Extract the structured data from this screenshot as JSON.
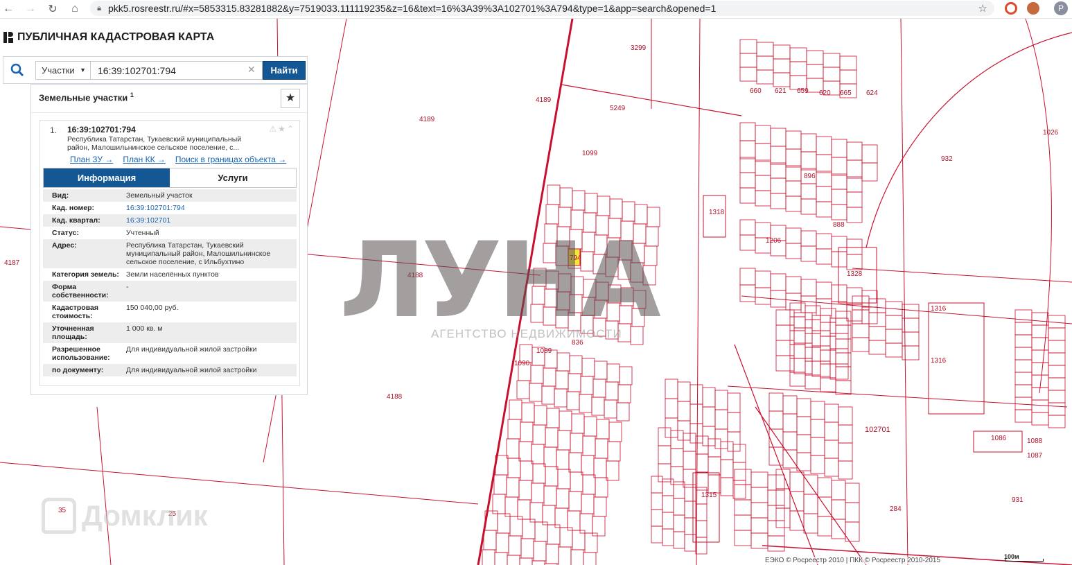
{
  "browser": {
    "url": "pkk5.rosreestr.ru/#x=5853315.83281882&y=7519033.111119235&z=16&text=16%3A39%3A102701%3A794&type=1&app=search&opened=1",
    "profile_initial": "P"
  },
  "app": {
    "title": "ПУБЛИЧНАЯ КАДАСТРОВАЯ КАРТА"
  },
  "search": {
    "type_value": "Участки",
    "query": "16:39:102701:794",
    "button_label": "Найти"
  },
  "results": {
    "header": "Земельные участки",
    "count": "1",
    "item": {
      "number": "1.",
      "title": "16:39:102701:794",
      "address_short": "Республика Татарстан, Тукаевский муниципальный район, Малошильнинское сельское поселение, с...",
      "links": [
        "План ЗУ →",
        "План КК →",
        "Поиск в границах объекта →"
      ],
      "tabs": [
        "Информация",
        "Услуги"
      ],
      "info": [
        {
          "k": "Вид:",
          "v": "Земельный участок"
        },
        {
          "k": "Кад. номер:",
          "v": "16:39:102701:794",
          "link": true
        },
        {
          "k": "Кад. квартал:",
          "v": "16:39:102701",
          "link": true
        },
        {
          "k": "Статус:",
          "v": "Учтенный"
        },
        {
          "k": "Адрес:",
          "v": "Республика Татарстан, Тукаевский муниципальный район, Малошильнинское сельское поселение, с Ильбухтино"
        },
        {
          "k": "Категория земель:",
          "v": "Земли населённых пунктов"
        },
        {
          "k": "Форма собственности:",
          "v": "-"
        },
        {
          "k": "Кадастровая стоимость:",
          "v": "150 040,00 руб."
        },
        {
          "k": "Уточненная площадь:",
          "v": "1 000 кв. м"
        },
        {
          "k": "Разрешенное использование:",
          "v": "Для индивидуальной жилой застройки"
        },
        {
          "k": "по документу:",
          "v": "Для индивидуальной жилой застройки"
        }
      ]
    }
  },
  "map": {
    "line_color": "#c8102e",
    "highlight_color": "#f5e63c",
    "area_labels": [
      "3299",
      "4189",
      "4189",
      "5249",
      "1099",
      "4187",
      "4188",
      "4188",
      "932",
      "1026",
      "102701",
      "1316",
      "1316",
      "1328",
      "284",
      "931",
      "1086",
      "1088",
      "1087",
      "25",
      "35",
      "1089",
      "1090",
      "1318",
      "896",
      "888",
      "624",
      "660",
      "621",
      "659",
      "620",
      "665",
      "1206",
      "1315",
      "836"
    ],
    "selected_parcel": "794",
    "scale_label": "100м",
    "copyright": "ЕЭКО © Росреестр 2010 | ПКК © Росреестр 2010-2015"
  },
  "watermarks": {
    "luna": "ЛУНА",
    "agency": "АГЕНТСТВО НЕДВИЖИМОСТИ",
    "domclick": "Домклик"
  }
}
